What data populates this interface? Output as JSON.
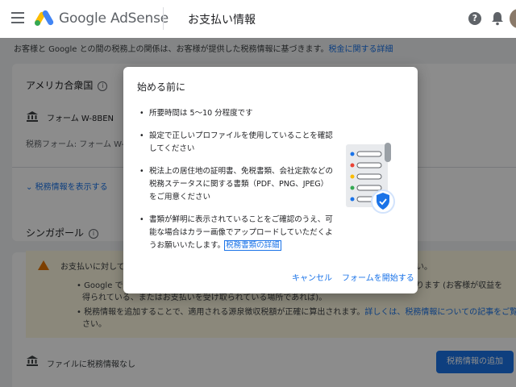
{
  "header": {
    "brand": "Google AdSense",
    "page_title": "お支払い情報"
  },
  "page": {
    "intro_text": "お客様と Google との間の税務上の関係は、お客様が提供した税務情報に基づきます。",
    "intro_link": "税金に関する詳細",
    "usa_section": {
      "title": "アメリカ合衆国",
      "form_name": "フォーム W-8BEN",
      "tax_form_label": "税務フォーム: フォーム W-8BE",
      "show_info_link": "税務情報を表示する"
    },
    "singapore_section": {
      "title": "シンガポール",
      "warning_line1": "お支払いに対して",
      "warning_line1_end": "い。",
      "warning_bullet1_start": "• Google では",
      "warning_bullet1_end": "ります (お客様が収益を",
      "warning_bullet1_line2": "得られている、またはお支払いを受け取られている場所であれば)。",
      "warning_bullet2": "• 税務情報を追加することで、適用される源泉徴収税額が正確に算出されます。",
      "warning_bullet2_link": "詳しくは、税務情報についての記事をご覧くだ",
      "warning_bullet2_line2": "さい。",
      "no_file_text": "ファイルに税務情報なし",
      "add_button": "税務情報の追加"
    }
  },
  "dialog": {
    "title": "始める前に",
    "items": [
      "所要時間は 5〜10 分程度です",
      "設定で正しいプロファイルを使用していることを確認してください",
      "税法上の居住地の証明書、免税書類、会社定款などの税務ステータスに関する書類（PDF、PNG、JPEG）をご用意ください",
      "書類が鮮明に表示されていることをご確認のうえ、可能な場合はカラー画像でアップロードしていただくようお願いいたします。"
    ],
    "detail_link": "税務書類の詳細",
    "cancel_label": "キャンセル",
    "start_label": "フォームを開始する"
  },
  "colors": {
    "accent": "#1a73e8",
    "warning_bg": "#fef7e0",
    "warning_icon": "#e37400"
  }
}
